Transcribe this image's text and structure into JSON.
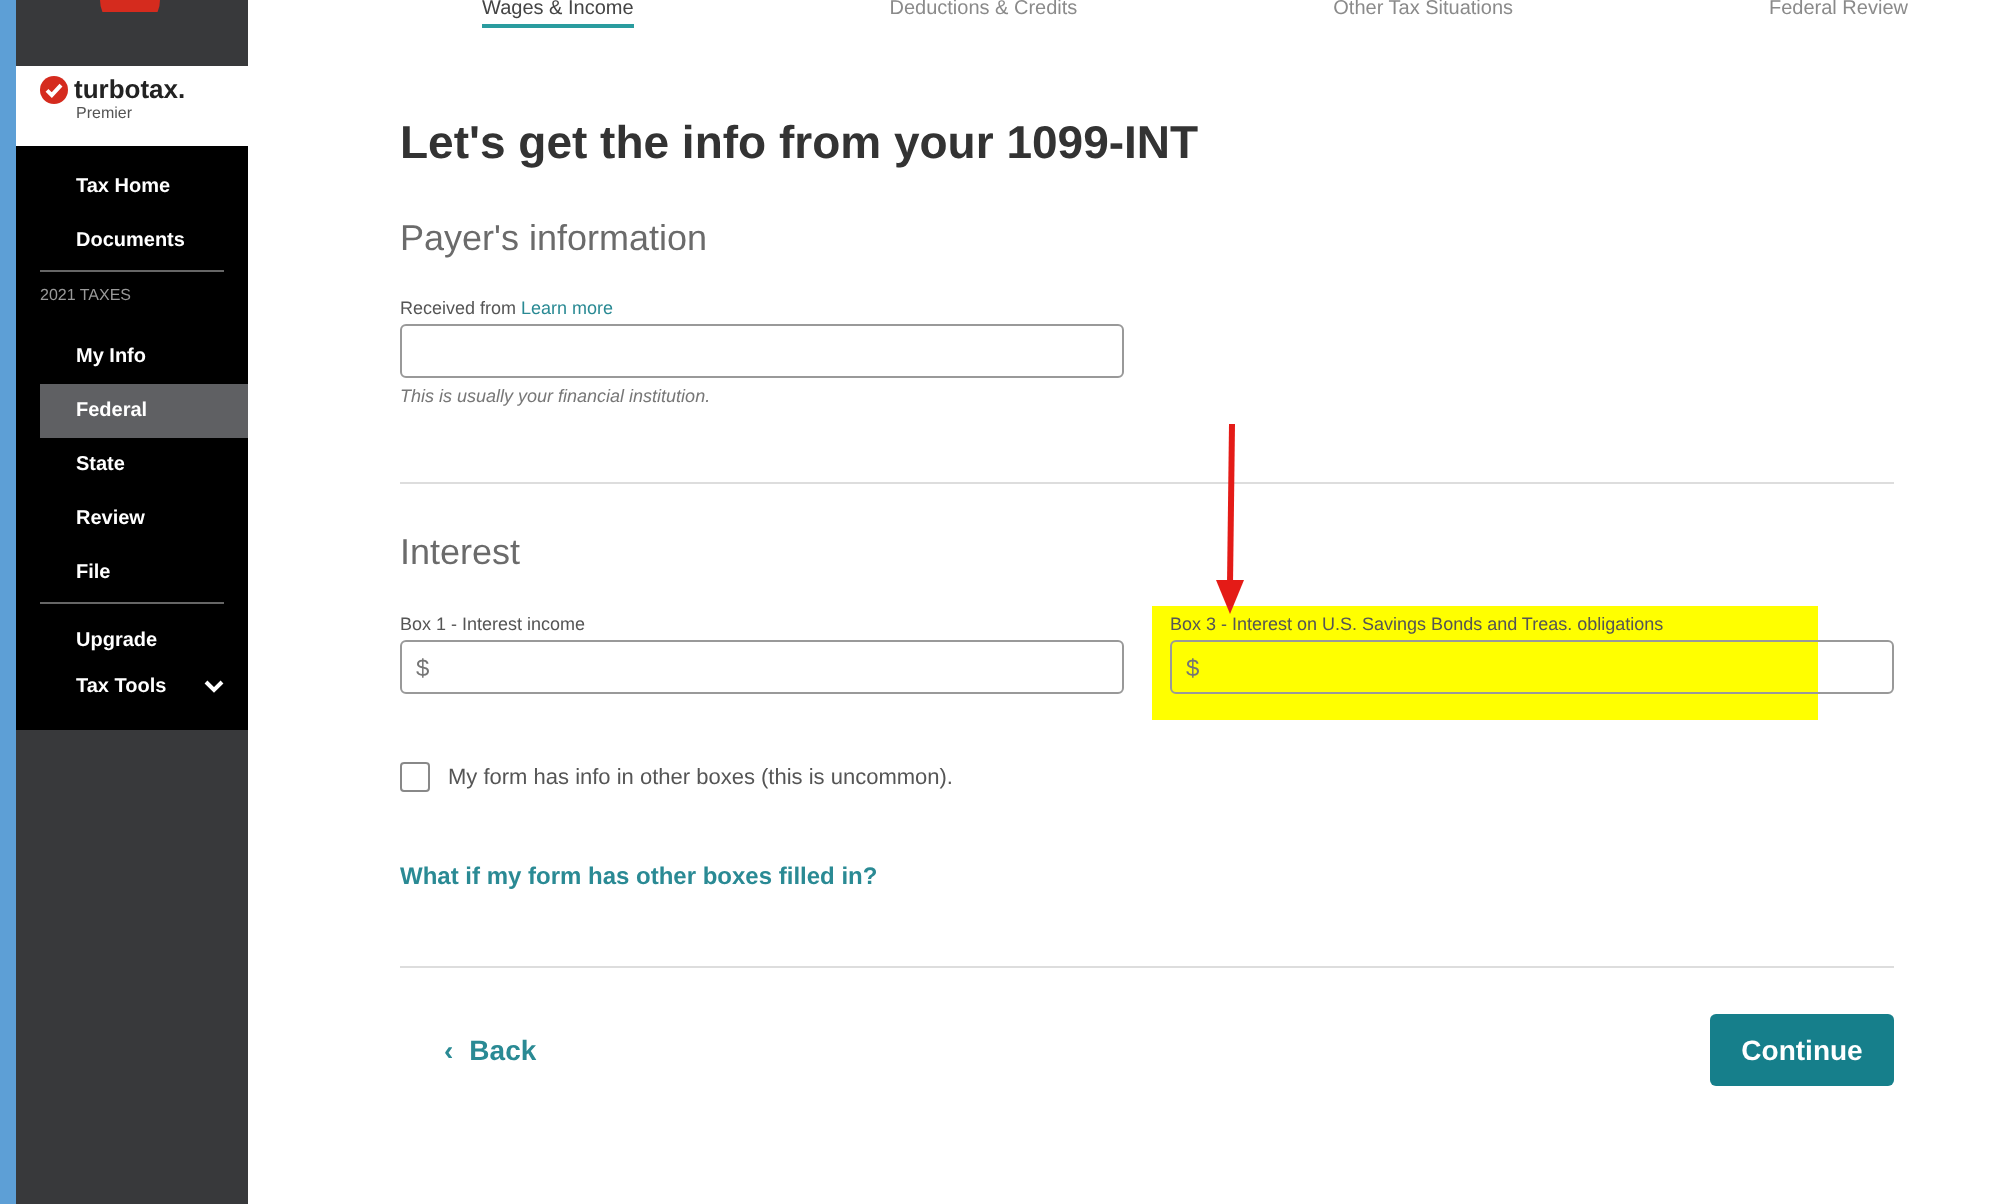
{
  "sidebar": {
    "brand": "turbotax.",
    "edition": "Premier",
    "items": [
      {
        "label": "Tax Home",
        "kind": "item",
        "selected": false
      },
      {
        "label": "Documents",
        "kind": "item",
        "selected": false
      },
      {
        "kind": "divider"
      },
      {
        "label": "2021 TAXES",
        "kind": "section"
      },
      {
        "label": "My Info",
        "kind": "item",
        "selected": false
      },
      {
        "label": "Federal",
        "kind": "item",
        "selected": true
      },
      {
        "label": "State",
        "kind": "item",
        "selected": false
      },
      {
        "label": "Review",
        "kind": "item",
        "selected": false
      },
      {
        "label": "File",
        "kind": "item",
        "selected": false
      },
      {
        "kind": "divider"
      },
      {
        "label": "Upgrade",
        "kind": "small",
        "selected": false
      },
      {
        "label": "Tax Tools",
        "kind": "dropdown",
        "selected": false
      }
    ]
  },
  "tabs": [
    {
      "label": "Wages & Income",
      "selected": true
    },
    {
      "label": "Deductions & Credits",
      "selected": false
    },
    {
      "label": "Other Tax Situations",
      "selected": false
    },
    {
      "label": "Federal Review",
      "selected": false
    }
  ],
  "heading": "Let's get the info from your 1099-INT",
  "payer": {
    "title": "Payer's information",
    "label": "Received from",
    "link": "Learn more",
    "hint": "This is usually your financial institution."
  },
  "interest": {
    "title": "Interest",
    "fields": [
      {
        "label": "Box 1 - Interest income",
        "placeholder": "$",
        "highlighted": false
      },
      {
        "label": "Box 3 - Interest on U.S. Savings Bonds and Treas. obligations",
        "placeholder": "$",
        "highlighted": true
      }
    ]
  },
  "checkbox": {
    "label": "My form has info in other boxes (this is uncommon).",
    "checked": false
  },
  "help_link": "What if my form has other boxes filled in?",
  "back": {
    "icon": "‹",
    "label": "Back"
  },
  "continue": "Continue"
}
